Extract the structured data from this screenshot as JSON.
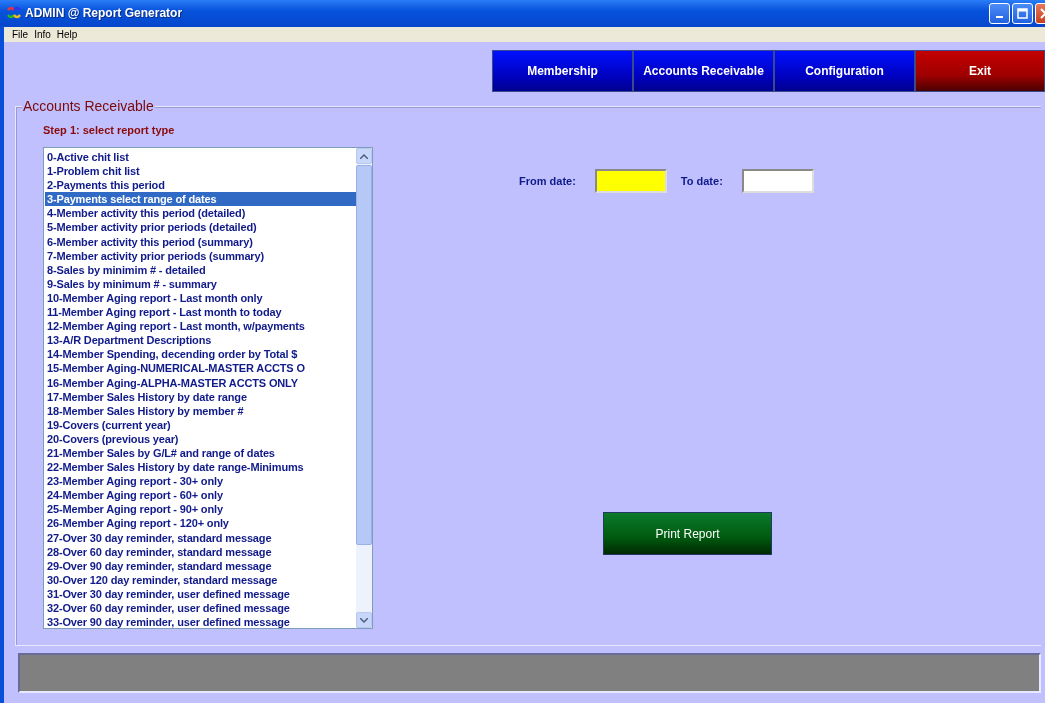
{
  "window": {
    "title": "ADMIN @ Report Generator"
  },
  "menu": [
    {
      "label": "File"
    },
    {
      "label": "Info"
    },
    {
      "label": "Help"
    }
  ],
  "nav_buttons": [
    {
      "label": "Membership",
      "kind": "nav"
    },
    {
      "label": "Accounts Receivable",
      "kind": "nav"
    },
    {
      "label": "Configuration",
      "kind": "nav"
    },
    {
      "label": "Exit",
      "kind": "exit"
    }
  ],
  "group": {
    "title": "Accounts Receivable",
    "step_label": "Step 1: select report type",
    "reports": [
      {
        "label": "0-Active chit list",
        "selected": false
      },
      {
        "label": "1-Problem chit list",
        "selected": false
      },
      {
        "label": "2-Payments this period",
        "selected": false
      },
      {
        "label": "3-Payments select range of dates",
        "selected": true
      },
      {
        "label": "4-Member activity this period (detailed)",
        "selected": false
      },
      {
        "label": "5-Member activity prior periods (detailed)",
        "selected": false
      },
      {
        "label": "6-Member activity this period (summary)",
        "selected": false
      },
      {
        "label": "7-Member activity prior periods (summary)",
        "selected": false
      },
      {
        "label": "8-Sales by minimim # - detailed",
        "selected": false
      },
      {
        "label": "9-Sales by minimum # - summary",
        "selected": false
      },
      {
        "label": "10-Member Aging report - Last month only",
        "selected": false
      },
      {
        "label": "11-Member Aging report - Last month to today",
        "selected": false
      },
      {
        "label": "12-Member Aging report - Last month, w/payments",
        "selected": false
      },
      {
        "label": "13-A/R Department Descriptions",
        "selected": false
      },
      {
        "label": "14-Member Spending, decending order by Total $",
        "selected": false
      },
      {
        "label": "15-Member Aging-NUMERICAL-MASTER ACCTS O",
        "selected": false
      },
      {
        "label": "16-Member Aging-ALPHA-MASTER ACCTS ONLY",
        "selected": false
      },
      {
        "label": "17-Member Sales History by date range",
        "selected": false
      },
      {
        "label": "18-Member Sales History by member #",
        "selected": false
      },
      {
        "label": "19-Covers (current year)",
        "selected": false
      },
      {
        "label": "20-Covers (previous year)",
        "selected": false
      },
      {
        "label": "21-Member Sales by G/L# and range of dates",
        "selected": false
      },
      {
        "label": "22-Member Sales History by date range-Minimums",
        "selected": false
      },
      {
        "label": "23-Member Aging report - 30+ only",
        "selected": false
      },
      {
        "label": "24-Member Aging report - 60+ only",
        "selected": false
      },
      {
        "label": "25-Member Aging report - 90+ only",
        "selected": false
      },
      {
        "label": "26-Member Aging report - 120+ only",
        "selected": false
      },
      {
        "label": "27-Over 30 day reminder, standard message",
        "selected": false
      },
      {
        "label": "28-Over 60 day reminder, standard message",
        "selected": false
      },
      {
        "label": "29-Over 90 day reminder, standard message",
        "selected": false
      },
      {
        "label": "30-Over 120 day reminder, standard message",
        "selected": false
      },
      {
        "label": "31-Over 30 day reminder, user defined message",
        "selected": false
      },
      {
        "label": "32-Over 60 day reminder, user defined message",
        "selected": false
      },
      {
        "label": "33-Over 90 day reminder, user defined message",
        "selected": false
      }
    ],
    "date_fields": [
      {
        "label": "From date:",
        "focused": true
      },
      {
        "label": "To date:",
        "focused": false
      }
    ],
    "print_button": {
      "label": "Print Report"
    }
  }
}
